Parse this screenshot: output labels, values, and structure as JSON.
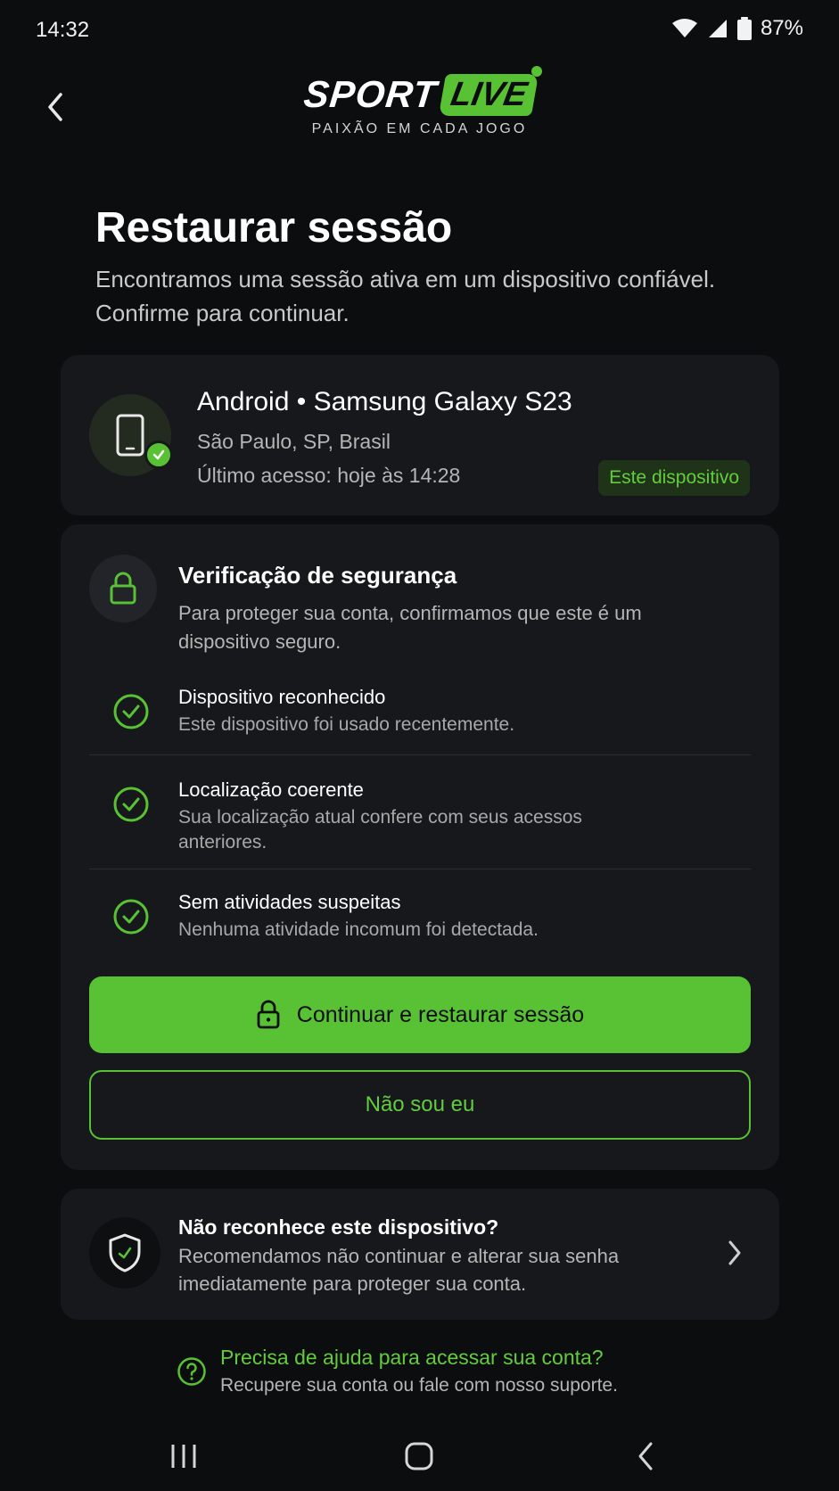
{
  "status_bar": {
    "time": "14:32",
    "battery": "87%"
  },
  "brand": {
    "sport": "SPORT",
    "live": "LIVE",
    "tagline": "PAIXÃO EM CADA JOGO",
    "accent": "#58c234"
  },
  "page": {
    "title": "Restaurar sessão",
    "subtitle": "Encontramos uma sessão ativa em um dispositivo confiável. Confirme para continuar."
  },
  "device": {
    "name": "Android • Samsung Galaxy S23",
    "location": "São Paulo, SP, Brasil",
    "last_access": "Último acesso: hoje às 14:28",
    "badge": "Este dispositivo"
  },
  "security": {
    "title": "Verificação de segurança",
    "description": "Para proteger sua conta, confirmamos que este é um dispositivo seguro.",
    "checks": [
      {
        "title": "Dispositivo reconhecido",
        "description": "Este dispositivo foi usado recentemente."
      },
      {
        "title": "Localização coerente",
        "description": "Sua localização atual confere com seus acessos anteriores."
      },
      {
        "title": "Sem atividades suspeitas",
        "description": "Nenhuma atividade incomum foi detectada."
      }
    ],
    "primary_button": "Continuar e restaurar sessão",
    "secondary_button": "Não sou eu"
  },
  "warning": {
    "title": "Não reconhece este dispositivo?",
    "description": "Recomendamos não continuar e alterar sua senha imediatamente para proteger sua conta."
  },
  "help": {
    "title": "Precisa de ajuda para acessar sua conta?",
    "description": "Recupere sua conta ou fale com nosso suporte."
  },
  "icons": [
    "back-arrow-icon",
    "phone-icon",
    "check-icon",
    "lock-icon",
    "check-circle-icon",
    "shield-icon",
    "chevron-right-icon",
    "help-circle-icon",
    "recents-icon",
    "home-icon",
    "nav-back-icon"
  ]
}
